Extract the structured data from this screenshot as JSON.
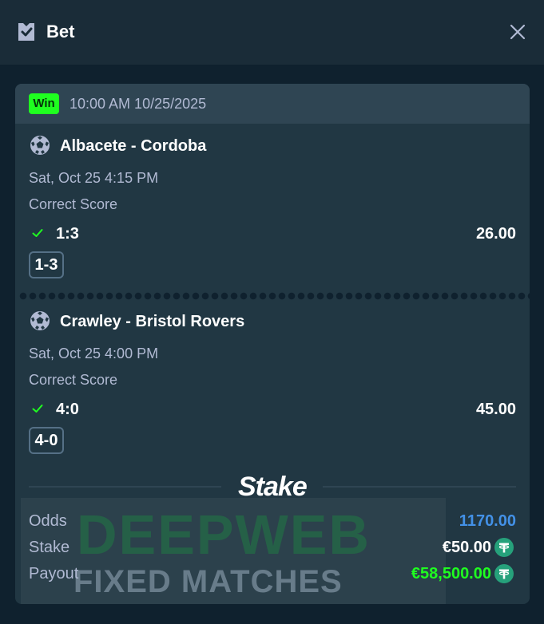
{
  "header": {
    "title": "Bet"
  },
  "bet": {
    "status_badge": "Win",
    "placed_at": "10:00 AM 10/25/2025"
  },
  "selections": [
    {
      "match": "Albacete - Cordoba",
      "date": "Sat, Oct 25  4:15 PM",
      "market": "Correct Score",
      "pick": "1:3",
      "odds": "26.00",
      "score_chip": "1-3"
    },
    {
      "match": "Crawley - Bristol Rovers",
      "date": "Sat, Oct 25  4:00 PM",
      "market": "Correct Score",
      "pick": "4:0",
      "odds": "45.00",
      "score_chip": "4-0"
    }
  ],
  "brand": {
    "logo_text": "Stake"
  },
  "summary": {
    "odds_label": "Odds",
    "odds_value": "1170.00",
    "stake_label": "Stake",
    "stake_value": "€50.00",
    "payout_label": "Payout",
    "payout_value": "€58,500.00",
    "currency_icon": "tether-coin-icon"
  },
  "watermark": {
    "line1": "DEEPWEB",
    "line2": "FIXED MATCHES"
  },
  "colors": {
    "win_badge": "#1fff20",
    "odds_total": "#4391e7",
    "payout": "#1fff20",
    "coin": "#26a17b"
  }
}
